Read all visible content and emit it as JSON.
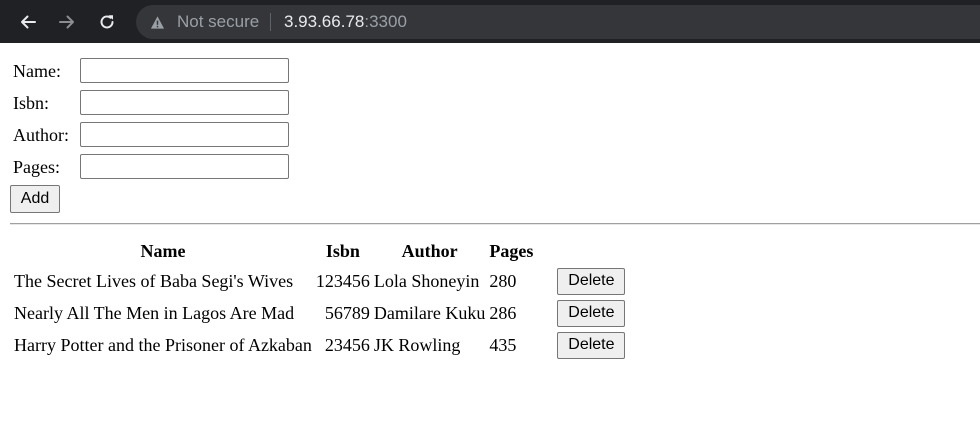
{
  "browser": {
    "security_text": "Not secure",
    "url_host": "3.93.66.78",
    "url_port": ":3300",
    "icons": [
      "back-icon",
      "forward-icon",
      "reload-icon",
      "warning-icon"
    ]
  },
  "form": {
    "fields": [
      {
        "label": "Name:",
        "value": ""
      },
      {
        "label": "Isbn:",
        "value": ""
      },
      {
        "label": "Author:",
        "value": ""
      },
      {
        "label": "Pages:",
        "value": ""
      }
    ],
    "add_label": "Add"
  },
  "table": {
    "headers": [
      "Name",
      "Isbn",
      "Author",
      "Pages"
    ],
    "rows": [
      {
        "name": "The Secret Lives of Baba Segi's Wives",
        "isbn": "123456",
        "author": "Lola Shoneyin",
        "pages": "280",
        "delete_label": "Delete"
      },
      {
        "name": "Nearly All The Men in Lagos Are Mad",
        "isbn": "56789",
        "author": "Damilare Kuku",
        "pages": "286",
        "delete_label": "Delete"
      },
      {
        "name": "Harry Potter and the Prisoner of Azkaban",
        "isbn": "23456",
        "author": "JK Rowling",
        "pages": "435",
        "delete_label": "Delete"
      }
    ]
  }
}
